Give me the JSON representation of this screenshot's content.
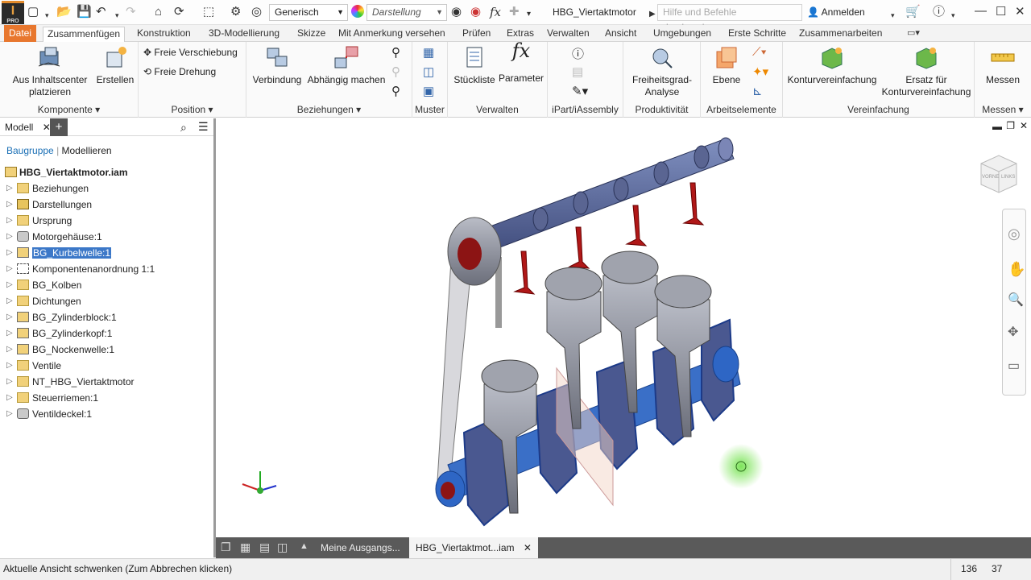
{
  "app": {
    "logo": "I",
    "logo_sub": "PRO"
  },
  "qat": {
    "material": "Generisch",
    "appearance": "Darstellung",
    "fx": "fx",
    "document": "HBG_Viertaktmotor",
    "search_placeholder": "Hilfe und Befehle durchsuchen...",
    "signin": "Anmelden"
  },
  "tabs": [
    "Datei",
    "Zusammenfügen",
    "Konstruktion",
    "3D-Modellierung",
    "Skizze",
    "Mit Anmerkung versehen",
    "Prüfen",
    "Extras",
    "Verwalten",
    "Ansicht",
    "Umgebungen",
    "Erste Schritte",
    "Zusammenarbeiten"
  ],
  "ribbon": {
    "komponente": {
      "title": "Komponente",
      "place": [
        "Aus Inhaltscenter",
        "platzieren"
      ],
      "create": "Erstellen"
    },
    "position": {
      "title": "Position",
      "free_move": "Freie Verschiebung",
      "free_rotate": "Freie Drehung"
    },
    "beziehungen": {
      "title": "Beziehungen",
      "joint": "Verbindung",
      "constrain": "Abhängig machen"
    },
    "muster": {
      "title": "Muster"
    },
    "verwalten": {
      "title": "Verwalten",
      "bom": "Stückliste",
      "params": "Parameter"
    },
    "ipart": {
      "title": "iPart/iAssembly"
    },
    "produktivitaet": {
      "title": "Produktivität",
      "dof": [
        "Freiheitsgrad-",
        "Analyse"
      ]
    },
    "arbeitselemente": {
      "title": "Arbeitselemente",
      "plane": "Ebene"
    },
    "vereinfachung": {
      "title": "Vereinfachung",
      "shrinkwrap": "Konturvereinfachung",
      "substitute": [
        "Ersatz für",
        "Konturvereinfachung"
      ]
    },
    "messen": {
      "title": "Messen",
      "measure": "Messen"
    }
  },
  "sidebar": {
    "tab": "Modell",
    "plus": "+",
    "link_assembly": "Baugruppe",
    "link_modeling": "Modellieren",
    "root": "HBG_Viertaktmotor.iam",
    "items": [
      {
        "label": "Beziehungen",
        "icon": "folder-icon"
      },
      {
        "label": "Darstellungen",
        "icon": "representations-icon"
      },
      {
        "label": "Ursprung",
        "icon": "folder-icon"
      },
      {
        "label": "Motorgehäuse:1",
        "icon": "part-icon"
      },
      {
        "label": "BG_Kurbelwelle:1",
        "icon": "subassembly-icon",
        "selected": true
      },
      {
        "label": "Komponentenanordnung 1:1",
        "icon": "layout-icon"
      },
      {
        "label": "BG_Kolben",
        "icon": "folder-icon"
      },
      {
        "label": "Dichtungen",
        "icon": "folder-icon"
      },
      {
        "label": "BG_Zylinderblock:1",
        "icon": "subassembly-icon"
      },
      {
        "label": "BG_Zylinderkopf:1",
        "icon": "subassembly-icon"
      },
      {
        "label": "BG_Nockenwelle:1",
        "icon": "subassembly-icon"
      },
      {
        "label": "Ventile",
        "icon": "folder-icon"
      },
      {
        "label": "NT_HBG_Viertaktmotor",
        "icon": "folder-icon"
      },
      {
        "label": "Steuerriemen:1",
        "icon": "belt-icon"
      },
      {
        "label": "Ventildeckel:1",
        "icon": "part-icon"
      }
    ]
  },
  "doctabs": [
    "Meine Ausgangs...",
    "HBG_Viertaktmot...iam"
  ],
  "status": {
    "message": "Aktuelle Ansicht schwenken (Zum Abbrechen klicken)",
    "n1": "136",
    "n2": "37"
  },
  "viewcube": {
    "face1": "VORNE",
    "face2": "LINKS"
  },
  "colors": {
    "file_tab": "#e8772e",
    "selection": "#3c78c8",
    "link": "#1a6fb5"
  }
}
